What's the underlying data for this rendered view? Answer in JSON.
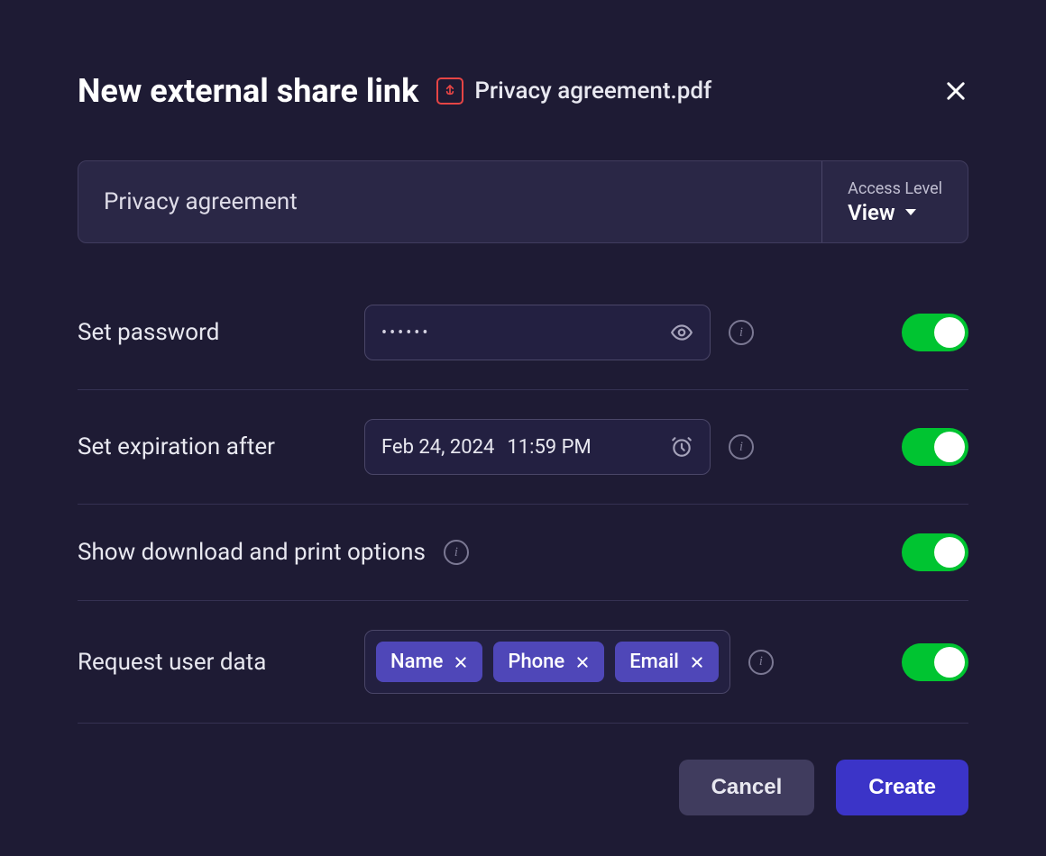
{
  "dialog": {
    "title": "New external share link",
    "file_name": "Privacy agreement.pdf"
  },
  "topField": {
    "name_value": "Privacy agreement",
    "access_label": "Access Level",
    "access_value": "View"
  },
  "password": {
    "label": "Set password",
    "masked": "••••••"
  },
  "expiration": {
    "label": "Set expiration after",
    "date": "Feb 24, 2024",
    "time": "11:59 PM"
  },
  "download": {
    "label": "Show download and print options"
  },
  "requestData": {
    "label": "Request user data",
    "chips": [
      "Name",
      "Phone",
      "Email"
    ]
  },
  "footer": {
    "cancel": "Cancel",
    "create": "Create"
  }
}
